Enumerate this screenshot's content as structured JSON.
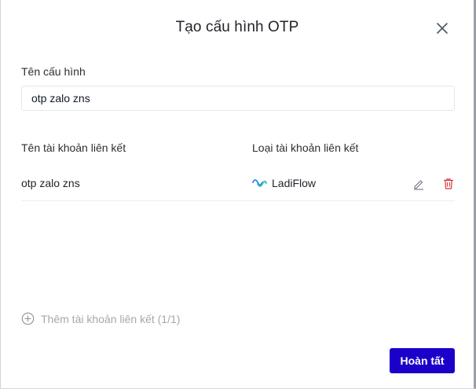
{
  "dialog": {
    "title": "Tạo cấu hình OTP",
    "close_icon": "close-icon"
  },
  "config_name": {
    "label": "Tên cấu hình",
    "value": "otp zalo zns"
  },
  "linked_accounts": {
    "columns": {
      "name": "Tên tài khoản liên kết",
      "type": "Loại tài khoản liên kết"
    },
    "rows": [
      {
        "name": "otp zalo zns",
        "type_label": "LadiFlow",
        "type_icon": "ladiflow-logo-icon",
        "actions": [
          "pencil-icon",
          "trash-icon"
        ]
      }
    ],
    "add_label": "Thêm tài khoản liên kết (1/1)",
    "add_icon": "plus-circle-icon"
  },
  "footer": {
    "submit_label": "Hoàn tất"
  },
  "colors": {
    "primary": "#1b00c9",
    "danger": "#d9363e",
    "muted": "#a3a8ae",
    "brand_blue": "#2d7ff9",
    "brand_teal": "#22c3a6"
  }
}
